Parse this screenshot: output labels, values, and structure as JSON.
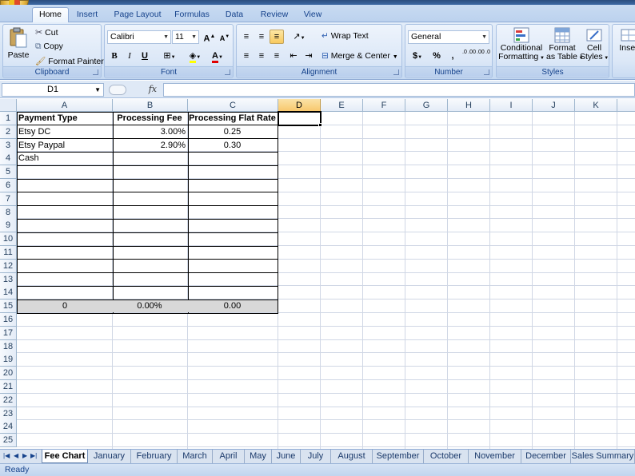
{
  "app": {
    "status": "Ready"
  },
  "ribbon_tabs": [
    "Home",
    "Insert",
    "Page Layout",
    "Formulas",
    "Data",
    "Review",
    "View"
  ],
  "clipboard": {
    "paste": "Paste",
    "cut": "Cut",
    "copy": "Copy",
    "format_painter": "Format Painter",
    "label": "Clipboard"
  },
  "font": {
    "name": "Calibri",
    "size": "11",
    "label": "Font",
    "bold": "B",
    "italic": "I",
    "underline": "U"
  },
  "alignment": {
    "wrap": "Wrap Text",
    "merge": "Merge & Center",
    "label": "Alignment"
  },
  "number": {
    "format": "General",
    "currency": "$",
    "percent": "%",
    "comma": ",",
    "inc_dec": ".0 .00",
    "dec_dec": ".00 .0",
    "label": "Number"
  },
  "styles": {
    "conditional": "Conditional",
    "conditional2": "Formatting",
    "format_as": "Format",
    "format_as2": "as Table",
    "cell": "Cell",
    "cell2": "Styles",
    "label": "Styles"
  },
  "cells": {
    "insert": "Inser"
  },
  "formula_bar": {
    "name_box": "D1",
    "fx": "fx",
    "value": ""
  },
  "columns": [
    "A",
    "B",
    "C",
    "D",
    "E",
    "F",
    "G",
    "H",
    "I",
    "J",
    "K"
  ],
  "rows": [
    "1",
    "2",
    "3",
    "4",
    "5",
    "6",
    "7",
    "8",
    "9",
    "10",
    "11",
    "12",
    "13",
    "14",
    "15",
    "16",
    "17",
    "18",
    "19",
    "20",
    "21",
    "22",
    "23",
    "24",
    "25"
  ],
  "sheet": {
    "header": {
      "a": "Payment Type",
      "b": "Processing Fee",
      "c": "Processing Flat Rate"
    },
    "data": [
      {
        "a": "Etsy DC",
        "b": "3.00%",
        "c": "0.25"
      },
      {
        "a": "Etsy Paypal",
        "b": "2.90%",
        "c": "0.30"
      },
      {
        "a": "Cash",
        "b": "",
        "c": ""
      }
    ],
    "totals": {
      "a": "0",
      "b": "0.00%",
      "c": "0.00"
    }
  },
  "sheet_tabs": [
    "Fee Chart",
    "January",
    "February",
    "March",
    "April",
    "May",
    "June",
    "July",
    "August",
    "September",
    "October",
    "November",
    "December",
    "Sales Summary"
  ]
}
